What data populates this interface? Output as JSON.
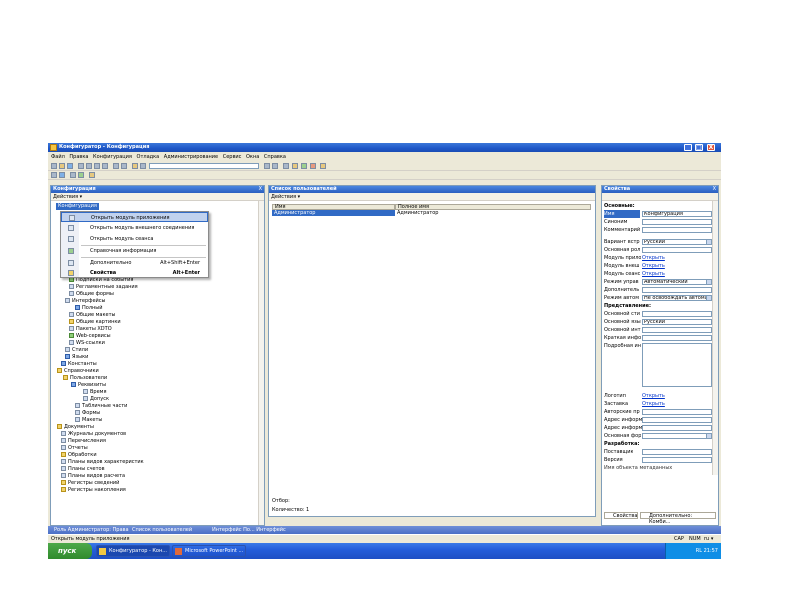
{
  "window": {
    "title": "Конфигуратор - Конфигурация",
    "min": "_",
    "max": "□",
    "close": "X"
  },
  "menu": [
    "Файл",
    "Правка",
    "Конфигурация",
    "Отладка",
    "Администрирование",
    "Сервис",
    "Окна",
    "Справка"
  ],
  "config_panel": {
    "title": "Конфигурация",
    "close": "X",
    "actions_label": "Действия ▾",
    "root_label": "Конфигурация",
    "tree": [
      "Подписки на события",
      "Регламентные задания",
      "Общие формы",
      "Интерфейсы",
      "Полный",
      "Общие макеты",
      "Общие картинки",
      "Пакеты XDTO",
      "Web-сервисы",
      "WS-ссылки",
      "Стили",
      "Языки",
      "Константы",
      "Справочники",
      "Пользователи",
      "Реквизиты",
      "Время",
      "Допуск",
      "Табличные части",
      "Формы",
      "Макеты",
      "Документы",
      "Журналы документов",
      "Перечисления",
      "Отчеты",
      "Обработки",
      "Планы видов характеристик",
      "Планы счетов",
      "Планы видов расчета",
      "Регистры сведений",
      "Регистры накопления"
    ]
  },
  "context_menu": {
    "items": [
      {
        "label": "Открыть модуль приложения",
        "key": ""
      },
      {
        "label": "Открыть модуль внешнего соединения",
        "key": ""
      },
      {
        "label": "Открыть модуль сеанса",
        "key": ""
      },
      {
        "label": "Справочная информация",
        "key": ""
      },
      {
        "label": "Дополнительно",
        "key": "Alt+Shift+Enter"
      },
      {
        "label": "Свойства",
        "key": "Alt+Enter"
      }
    ]
  },
  "users_panel": {
    "title": "Список пользователей",
    "actions_label": "Действия ▾",
    "col_name": "Имя",
    "col_fullname": "Полное имя",
    "row_name": "Администратор",
    "row_fullname": "Администратор",
    "selection_label": "Отбор:",
    "count_label": "Количество: 1"
  },
  "props_panel": {
    "title": "Свойства",
    "close": "X",
    "sections": {
      "basic": "Основные:",
      "presentation": "Представление:",
      "development": "Разработка:"
    },
    "rows_basic": [
      {
        "label": "Имя",
        "value": "Конфигурация"
      },
      {
        "label": "Синоним",
        "value": ""
      },
      {
        "label": "Комментарий",
        "value": ""
      }
    ],
    "rows_modes": [
      {
        "label": "Вариант встр",
        "value": "Русский",
        "kind": "combo"
      },
      {
        "label": "Основная рол",
        "value": "",
        "kind": "field"
      },
      {
        "label": "Модуль прило",
        "value": "Открыть",
        "kind": "link"
      },
      {
        "label": "Модуль внеш",
        "value": "Открыть",
        "kind": "link"
      },
      {
        "label": "Модуль сеанс",
        "value": "Открыть",
        "kind": "link"
      },
      {
        "label": "Режим управ",
        "value": "Автоматический",
        "kind": "combo"
      },
      {
        "label": "Дополнитель",
        "value": "",
        "kind": "field"
      },
      {
        "label": "Режим автом",
        "value": "Не освобождать автомат",
        "kind": "combo"
      }
    ],
    "rows_presentation": [
      {
        "label": "Основной сти",
        "value": ""
      },
      {
        "label": "Основной язы",
        "value": "Русский"
      },
      {
        "label": "Основной инт",
        "value": ""
      },
      {
        "label": "Краткая инфо",
        "value": ""
      },
      {
        "label": "Подробная ин",
        "value": ""
      }
    ],
    "rows_info": [
      {
        "label": "Логотип",
        "value": "Открыть"
      },
      {
        "label": "Заставка",
        "value": "Открыть"
      },
      {
        "label": "Авторские пр",
        "value": ""
      },
      {
        "label": "Адрес информ",
        "value": ""
      },
      {
        "label": "Адрес информ",
        "value": ""
      },
      {
        "label": "Основная фор",
        "value": ""
      }
    ],
    "rows_dev": [
      {
        "label": "Поставщик",
        "value": ""
      },
      {
        "label": "Версия",
        "value": ""
      }
    ],
    "hint": "Имя объекта метаданных",
    "tab_props": "Свойства",
    "tab_extra": "Дополнительно: Комби..."
  },
  "window_bar": {
    "item1": "Роль Администратор: Права",
    "item2": "Список пользователей",
    "item3": "Интерфейс По... Интерфейс"
  },
  "status": {
    "text": "Открыть модуль приложения",
    "caps": "CAP",
    "num": "NUM",
    "lang": "ru ▾"
  },
  "taskbar": {
    "start": "пуск",
    "task1": "Конфигуратор - Кон...",
    "task2": "Microsoft PowerPoint ...",
    "tray_lang": "RL",
    "clock": "21:57"
  }
}
